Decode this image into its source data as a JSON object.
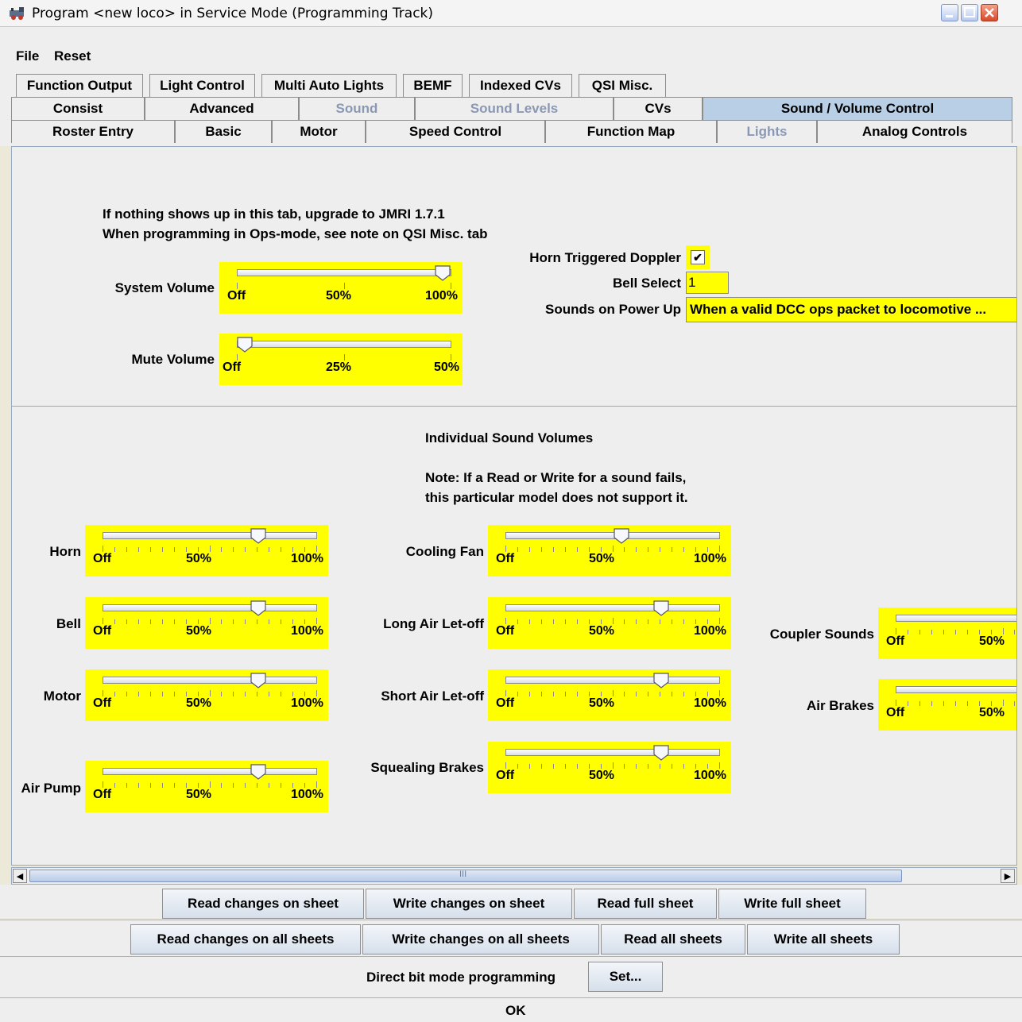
{
  "window": {
    "title": "Program <new loco> in Service Mode (Programming Track)"
  },
  "menubar": {
    "items": [
      "File",
      "Reset"
    ]
  },
  "tabs": {
    "row1": [
      "Function Output",
      "Light Control",
      "Multi Auto Lights",
      "BEMF",
      "Indexed CVs",
      "QSI Misc."
    ],
    "row2": [
      "Consist",
      "Advanced",
      "Sound",
      "Sound Levels",
      "CVs",
      "Sound / Volume Control"
    ],
    "row3": [
      "Roster Entry",
      "Basic",
      "Motor",
      "Speed Control",
      "Function Map",
      "Lights",
      "Analog Controls"
    ],
    "selected": "Sound / Volume Control",
    "disabled": [
      "Sound",
      "Sound Levels",
      "Lights"
    ]
  },
  "top_section": {
    "note_line1": "If nothing shows up in this tab, upgrade to JMRI 1.7.1",
    "note_line2": "When programming in Ops-mode, see note on QSI Misc. tab",
    "system_volume": {
      "label": "System Volume",
      "ticks": [
        "Off",
        "50%",
        "100%"
      ],
      "value_fraction": 0.995
    },
    "mute_volume": {
      "label": "Mute Volume",
      "ticks": [
        "Off",
        "25%",
        "50%"
      ],
      "value_fraction": 0.0
    },
    "horn_doppler": {
      "label": "Horn Triggered Doppler",
      "checked": true,
      "check_glyph": "✔"
    },
    "bell_select": {
      "label": "Bell Select",
      "value": "1"
    },
    "sounds_power_up": {
      "label": "Sounds on Power Up",
      "value": "When a valid DCC ops packet to locomotive ..."
    }
  },
  "individual": {
    "heading": "Individual Sound Volumes",
    "note_line1": "Note: If a Read or Write for a sound fails,",
    "note_line2": "this particular model does not support it.",
    "ticks": [
      "Off",
      "50%",
      "100%"
    ],
    "sliders": [
      {
        "label": "Horn",
        "value_fraction": 0.745
      },
      {
        "label": "Bell",
        "value_fraction": 0.745
      },
      {
        "label": "Motor",
        "value_fraction": 0.745
      },
      {
        "label": "Air Pump",
        "value_fraction": 0.745
      },
      {
        "label": "Cooling Fan",
        "value_fraction": 0.543
      },
      {
        "label": "Long Air Let-off",
        "value_fraction": 0.745
      },
      {
        "label": "Short Air Let-off",
        "value_fraction": 0.745
      },
      {
        "label": "Squealing Brakes",
        "value_fraction": 0.745
      },
      {
        "label": "Coupler Sounds",
        "value_fraction": null
      },
      {
        "label": "Air Brakes",
        "value_fraction": null
      }
    ]
  },
  "scrollbar": {
    "left_arrow": "◀",
    "right_arrow": "▶",
    "grip": "III"
  },
  "sheet_buttons": [
    "Read changes on sheet",
    "Write changes on sheet",
    "Read full sheet",
    "Write full sheet"
  ],
  "all_buttons": [
    "Read changes on all sheets",
    "Write changes on all sheets",
    "Read all sheets",
    "Write all sheets"
  ],
  "mode_row": {
    "label": "Direct bit mode programming",
    "set_button": "Set..."
  },
  "status": {
    "text": "OK"
  }
}
